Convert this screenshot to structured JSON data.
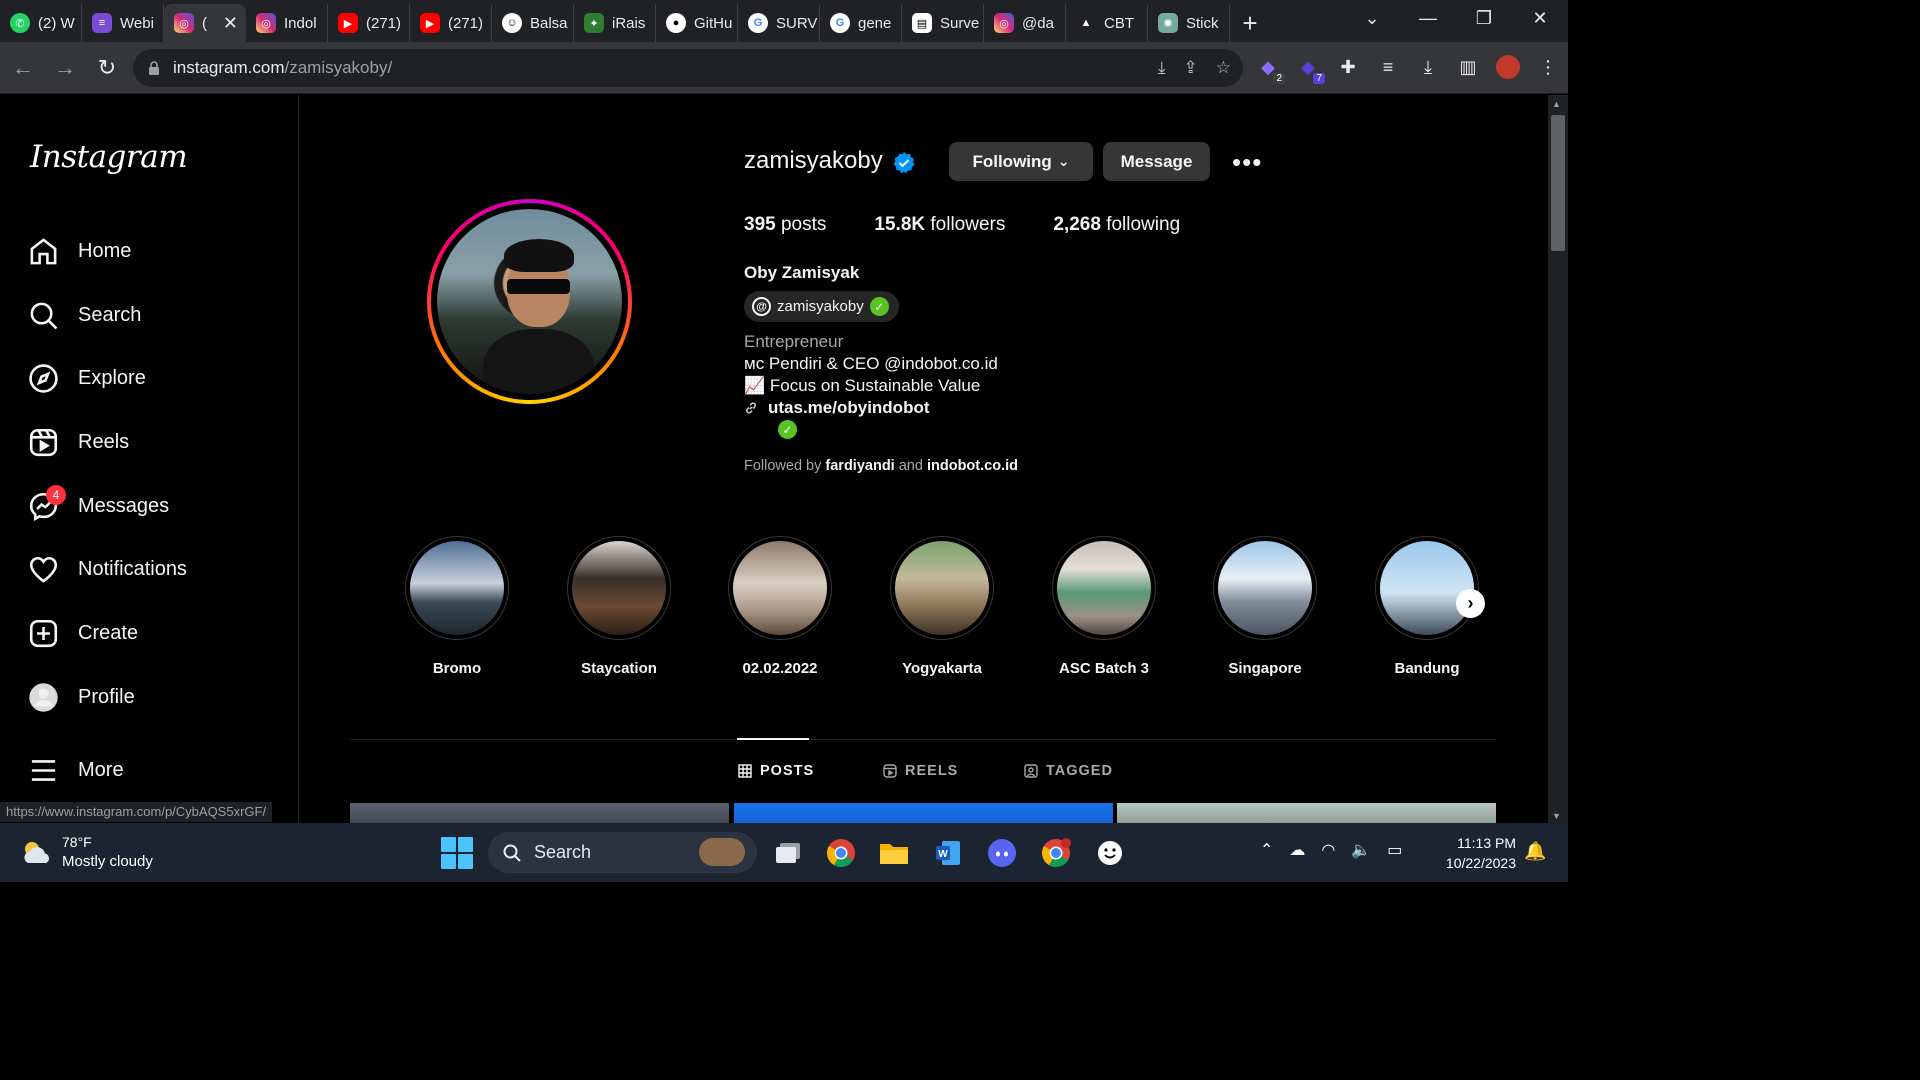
{
  "browser": {
    "tabs": [
      {
        "title": "(2) W",
        "icon": "whatsapp-icon",
        "color": "#25d366"
      },
      {
        "title": "Webi",
        "icon": "list-icon",
        "color": "#7b4bd6"
      },
      {
        "title": "(",
        "icon": "instagram-icon",
        "color": "#e1306c",
        "active": true
      },
      {
        "title": "Indol",
        "icon": "instagram-icon",
        "color": "#e1306c"
      },
      {
        "title": "(271)",
        "icon": "youtube-icon",
        "color": "#ff0000"
      },
      {
        "title": "(271)",
        "icon": "youtube-icon",
        "color": "#ff0000"
      },
      {
        "title": "Balsa",
        "icon": "smiley-icon",
        "color": "#ffffff"
      },
      {
        "title": "iRais",
        "icon": "iraise-icon",
        "color": "#2e7d32"
      },
      {
        "title": "GitHu",
        "icon": "github-icon",
        "color": "#ffffff"
      },
      {
        "title": "SURV",
        "icon": "google-icon",
        "color": "#4285f4"
      },
      {
        "title": "gene",
        "icon": "google-icon",
        "color": "#4285f4"
      },
      {
        "title": "Surve",
        "icon": "document-icon",
        "color": "#ffffff"
      },
      {
        "title": "@da",
        "icon": "instagram-icon",
        "color": "#e1306c"
      },
      {
        "title": "CBT",
        "icon": "triangle-icon",
        "color": "#ffffff"
      },
      {
        "title": "Stick",
        "icon": "chatgpt-icon",
        "color": "#74aa9c"
      }
    ],
    "url_host": "instagram.com",
    "url_path": "/zamisyakoby/",
    "extension_badges": [
      "2",
      "7"
    ],
    "status_url": "https://www.instagram.com/p/CybAQS5xrGF/"
  },
  "sidebar": {
    "logo": "Instagram",
    "items": [
      {
        "label": "Home",
        "icon": "home-icon"
      },
      {
        "label": "Search",
        "icon": "search-icon"
      },
      {
        "label": "Explore",
        "icon": "compass-icon"
      },
      {
        "label": "Reels",
        "icon": "reels-icon"
      },
      {
        "label": "Messages",
        "icon": "messenger-icon",
        "badge": "4"
      },
      {
        "label": "Notifications",
        "icon": "heart-icon"
      },
      {
        "label": "Create",
        "icon": "plus-square-icon"
      },
      {
        "label": "Profile",
        "icon": "avatar-icon"
      },
      {
        "label": "More",
        "icon": "hamburger-icon"
      }
    ]
  },
  "profile": {
    "username": "zamisyakoby",
    "following_button": "Following",
    "message_button": "Message",
    "more": "•••",
    "stats": {
      "posts_count": "395",
      "posts_label": "posts",
      "followers_count": "15.8K",
      "followers_label": "followers",
      "following_count": "2,268",
      "following_label": "following"
    },
    "full_name": "Oby Zamisyak",
    "threads_handle": "zamisyakoby",
    "category": "Entrepreneur",
    "bio_line1": "ᴍᴄ Pendiri & CEO @indobot.co.id",
    "bio_line2": "📈 Focus on Sustainable Value",
    "bio_link": "utas.me/obyindobot",
    "followed_by_prefix": "Followed by",
    "followed_by_user1": "fardiyandi",
    "followed_by_and": "and",
    "followed_by_user2": "indobot.co.id",
    "highlights": [
      "Bromo",
      "Staycation",
      "02.02.2022",
      "Yogyakarta",
      "ASC Batch 3",
      "Singapore",
      "Bandung"
    ],
    "tabs": [
      "POSTS",
      "REELS",
      "TAGGED"
    ]
  },
  "taskbar": {
    "weather_temp": "78°F",
    "weather_desc": "Mostly cloudy",
    "search_label": "Search",
    "time": "11:13 PM",
    "date": "10/22/2023"
  },
  "colors": {
    "accent_blue": "#0095f6",
    "badge_red": "#ff3040",
    "threads_green": "#58c322",
    "bg": "#000000"
  }
}
